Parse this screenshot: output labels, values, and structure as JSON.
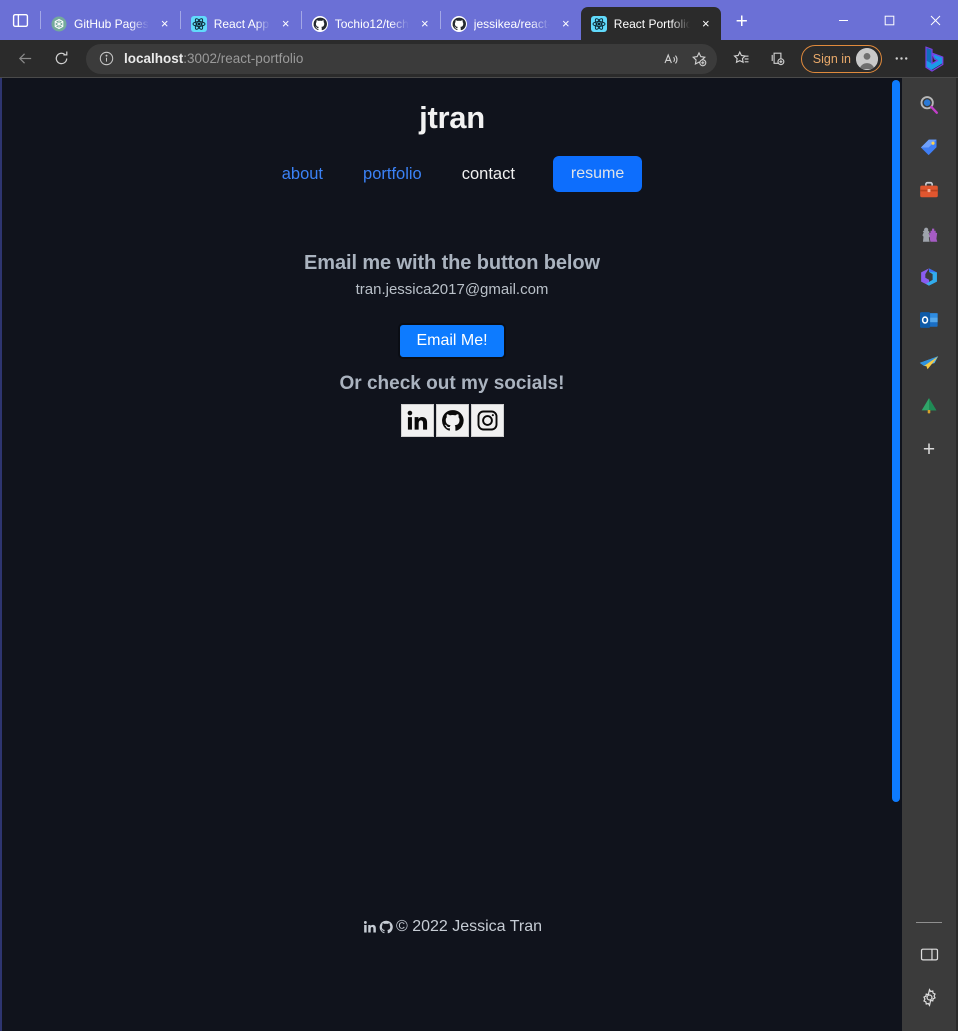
{
  "browser": {
    "tabs": [
      {
        "title": "GitHub Pages",
        "favicon": "openai-icon",
        "active": false
      },
      {
        "title": "React App",
        "favicon": "react-icon",
        "active": false
      },
      {
        "title": "Tochio12/tech",
        "favicon": "github-icon",
        "active": false
      },
      {
        "title": "jessikea/react-",
        "favicon": "github-icon",
        "active": false
      },
      {
        "title": "React Portfolio",
        "favicon": "react-icon",
        "active": true
      }
    ],
    "tab_close_label": "×",
    "new_tab_label": "+",
    "tab_search_icon": "tab-actions-icon",
    "window_controls": {
      "minimize": "minimize-icon",
      "maximize": "maximize-icon",
      "close": "close-icon"
    },
    "toolbar": {
      "back_icon": "back-arrow-icon",
      "refresh_icon": "refresh-icon",
      "site_info_icon": "info-circle-icon",
      "url_host": "localhost",
      "url_path": ":3002/react-portfolio",
      "url_full": "localhost:3002/react-portfolio",
      "read_aloud_icon": "read-aloud-icon",
      "add_favorite_icon": "add-favorite-icon",
      "favorites_icon": "favorites-list-icon",
      "collections_icon": "collections-icon",
      "sign_in_label": "Sign in",
      "profile_icon": "profile-avatar-icon",
      "settings_more_icon": "ellipsis-icon",
      "copilot_icon": "bing-copilot-icon"
    }
  },
  "sidebar": {
    "items": [
      {
        "name": "search-icon",
        "label": "Search"
      },
      {
        "name": "shopping-tag-icon",
        "label": "Shopping"
      },
      {
        "name": "briefcase-icon",
        "label": "Tools"
      },
      {
        "name": "games-icon",
        "label": "Games"
      },
      {
        "name": "office-icon",
        "label": "Microsoft 365"
      },
      {
        "name": "outlook-icon",
        "label": "Outlook"
      },
      {
        "name": "telegram-icon",
        "label": "Telegram"
      },
      {
        "name": "tree-icon",
        "label": "Tree"
      }
    ],
    "add_label": "+",
    "bottom": [
      {
        "name": "split-screen-icon",
        "label": "Split screen"
      },
      {
        "name": "gear-icon",
        "label": "Settings"
      }
    ]
  },
  "page": {
    "site_title": "jtran",
    "nav": [
      {
        "label": "about",
        "state": "link"
      },
      {
        "label": "portfolio",
        "state": "link"
      },
      {
        "label": "contact",
        "state": "active"
      },
      {
        "label": "resume",
        "state": "button"
      }
    ],
    "contact": {
      "heading": "Email me with the button below",
      "email": "tran.jessica2017@gmail.com",
      "email_button": "Email Me!",
      "socials_heading": "Or check out my socials!",
      "socials": [
        {
          "name": "linkedin-icon",
          "label": "LinkedIn"
        },
        {
          "name": "github-icon",
          "label": "GitHub"
        },
        {
          "name": "instagram-icon",
          "label": "Instagram"
        }
      ]
    },
    "footer": {
      "icons": [
        {
          "name": "linkedin-icon",
          "label": "LinkedIn"
        },
        {
          "name": "github-icon",
          "label": "GitHub"
        }
      ],
      "copyright": "© 2022 Jessica Tran"
    },
    "colors": {
      "background": "#10131c",
      "accent_blue": "#0d6efd",
      "button_blue": "#0d7bff",
      "heading_text": "#aab3bf",
      "scrollbar": "#0d7bff"
    }
  }
}
